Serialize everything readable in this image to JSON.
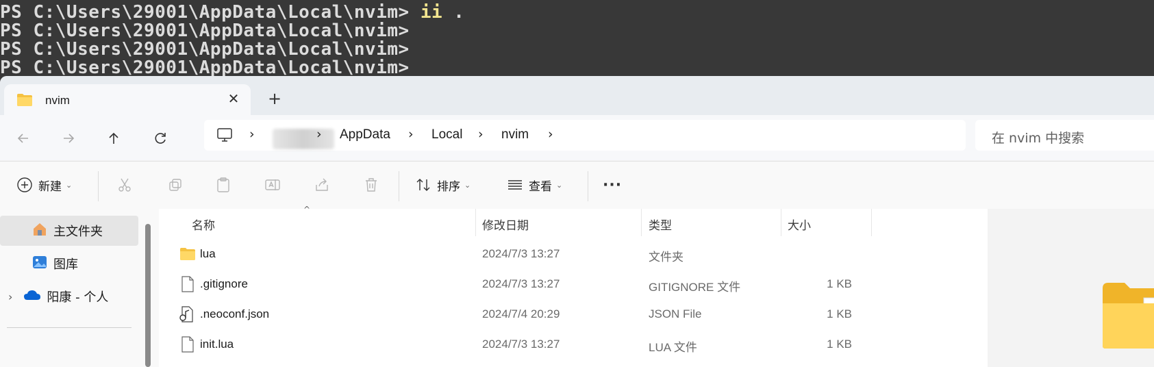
{
  "terminal": {
    "lines": [
      {
        "prompt": "PS C:\\Users\\29001\\AppData\\Local\\nvim>",
        "cmd": " ii",
        "arg": " ."
      },
      {
        "prompt": "PS C:\\Users\\29001\\AppData\\Local\\nvim>"
      },
      {
        "prompt": "PS C:\\Users\\29001\\AppData\\Local\\nvim>"
      },
      {
        "prompt": "PS C:\\Users\\29001\\AppData\\Local\\nvim>"
      }
    ]
  },
  "tab": {
    "title": "nvim",
    "close": "✕",
    "new": "+"
  },
  "nav": {
    "breadcrumbs": [
      "AppData",
      "Local",
      "nvim"
    ],
    "separator": "›",
    "search_placeholder": "在 nvim 中搜索"
  },
  "toolbar": {
    "new_label": "新建",
    "sort_label": "排序",
    "view_label": "查看",
    "more_label": "···"
  },
  "sidebar": {
    "items": [
      {
        "label": "主文件夹",
        "icon": "home-icon"
      },
      {
        "label": "图库",
        "icon": "gallery-icon"
      },
      {
        "label": "阳康 - 个人",
        "icon": "onedrive-icon"
      }
    ]
  },
  "filelist": {
    "headers": {
      "name": "名称",
      "modified": "修改日期",
      "type": "类型",
      "size": "大小"
    },
    "rows": [
      {
        "name": "lua",
        "modified": "2024/7/3 13:27",
        "type": "文件夹",
        "size": "",
        "icon": "folder-icon"
      },
      {
        "name": ".gitignore",
        "modified": "2024/7/3 13:27",
        "type": "GITIGNORE 文件",
        "size": "1 KB",
        "icon": "file-icon"
      },
      {
        "name": ".neoconf.json",
        "modified": "2024/7/4 20:29",
        "type": "JSON File",
        "size": "1 KB",
        "icon": "json-file-icon"
      },
      {
        "name": "init.lua",
        "modified": "2024/7/3 13:27",
        "type": "LUA 文件",
        "size": "1 KB",
        "icon": "file-icon"
      }
    ]
  },
  "colors": {
    "folder": "#f5c242",
    "accent": "#0067c0",
    "onedrive": "#0a64d4"
  }
}
